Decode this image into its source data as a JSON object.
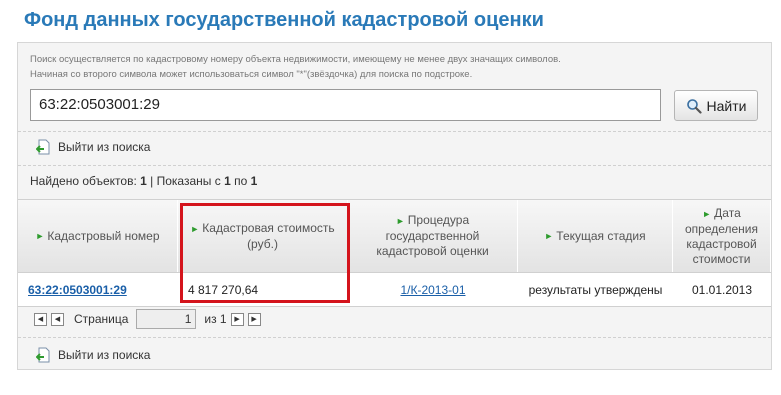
{
  "page_title": "Фонд данных государственной кадастровой оценки",
  "hint": {
    "line1": "Поиск осуществляется по кадастровому номеру объекта недвижимости, имеющему не менее двух значащих символов.",
    "line2": "Начиная со второго символа может использоваться символ \"*\"(звёздочка) для поиска по подстроке."
  },
  "search": {
    "value": "63:22:0503001:29",
    "button_label": "Найти"
  },
  "exit_label": "Выйти из поиска",
  "found": {
    "prefix": "Найдено объектов: ",
    "count": "1",
    "mid": " | Показаны с ",
    "from": "1",
    "to_word": " по ",
    "to": "1"
  },
  "table": {
    "headers": [
      "Кадастровый номер",
      "Кадастровая стоимость (руб.)",
      "Процедура государственной кадастровой оценки",
      "Текущая стадия",
      "Дата определения кадастровой стоимости"
    ],
    "row": {
      "number": "63:22:0503001:29",
      "value": "4 817 270,64",
      "procedure": "1/К-2013-01",
      "stage": "результаты утверждены",
      "date": "01.01.2013"
    }
  },
  "pager": {
    "page_label": "Страница",
    "page_value": "1",
    "of_label": "из 1"
  },
  "colors": {
    "title": "#2a7ab8",
    "link": "#1a5fa8",
    "highlight": "#d4141c",
    "arrow": "#2d9b2d"
  },
  "icons": {
    "search": "magnifier-icon",
    "exit": "exit-page-icon"
  }
}
